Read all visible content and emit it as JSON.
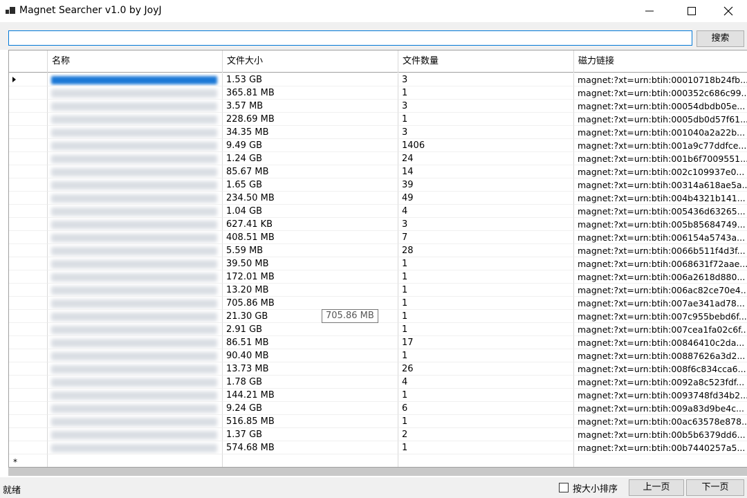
{
  "window": {
    "title": "Magnet Searcher v1.0 by JoyJ"
  },
  "search": {
    "value": "",
    "button_label": "搜索"
  },
  "grid": {
    "columns": [
      "名称",
      "文件大小",
      "文件数量",
      "磁力链接"
    ],
    "rows": [
      {
        "size": "1.53 GB",
        "count": "3",
        "magnet": "magnet:?xt=urn:btih:00010718b24fb..."
      },
      {
        "size": "365.81 MB",
        "count": "1",
        "magnet": "magnet:?xt=urn:btih:000352c686c99..."
      },
      {
        "size": "3.57 MB",
        "count": "3",
        "magnet": "magnet:?xt=urn:btih:00054dbdb05e..."
      },
      {
        "size": "228.69 MB",
        "count": "1",
        "magnet": "magnet:?xt=urn:btih:0005db0d57f61..."
      },
      {
        "size": "34.35 MB",
        "count": "3",
        "magnet": "magnet:?xt=urn:btih:001040a2a22b..."
      },
      {
        "size": "9.49 GB",
        "count": "1406",
        "magnet": "magnet:?xt=urn:btih:001a9c77ddfce..."
      },
      {
        "size": "1.24 GB",
        "count": "24",
        "magnet": "magnet:?xt=urn:btih:001b6f7009551..."
      },
      {
        "size": "85.67 MB",
        "count": "14",
        "magnet": "magnet:?xt=urn:btih:002c109937e0..."
      },
      {
        "size": "1.65 GB",
        "count": "39",
        "magnet": "magnet:?xt=urn:btih:00314a618ae5a..."
      },
      {
        "size": "234.50 MB",
        "count": "49",
        "magnet": "magnet:?xt=urn:btih:004b4321b141..."
      },
      {
        "size": "1.04 GB",
        "count": "4",
        "magnet": "magnet:?xt=urn:btih:005436d63265..."
      },
      {
        "size": "627.41 KB",
        "count": "3",
        "magnet": "magnet:?xt=urn:btih:005b85684749..."
      },
      {
        "size": "408.51 MB",
        "count": "7",
        "magnet": "magnet:?xt=urn:btih:006154a5743a..."
      },
      {
        "size": "5.59 MB",
        "count": "28",
        "magnet": "magnet:?xt=urn:btih:0066b511f4d3f..."
      },
      {
        "size": "39.50 MB",
        "count": "1",
        "magnet": "magnet:?xt=urn:btih:0068631f72aae..."
      },
      {
        "size": "172.01 MB",
        "count": "1",
        "magnet": "magnet:?xt=urn:btih:006a2618d880..."
      },
      {
        "size": "13.20 MB",
        "count": "1",
        "magnet": "magnet:?xt=urn:btih:006ac82ce70e4..."
      },
      {
        "size": "705.86 MB",
        "count": "1",
        "magnet": "magnet:?xt=urn:btih:007ae341ad78..."
      },
      {
        "size": "21.30 GB",
        "count": "1",
        "magnet": "magnet:?xt=urn:btih:007c955bebd6f..."
      },
      {
        "size": "2.91 GB",
        "count": "1",
        "magnet": "magnet:?xt=urn:btih:007cea1fa02c6f..."
      },
      {
        "size": "86.51 MB",
        "count": "17",
        "magnet": "magnet:?xt=urn:btih:00846410c2da..."
      },
      {
        "size": "90.40 MB",
        "count": "1",
        "magnet": "magnet:?xt=urn:btih:00887626a3d2..."
      },
      {
        "size": "13.73 MB",
        "count": "26",
        "magnet": "magnet:?xt=urn:btih:008f6c834cca6..."
      },
      {
        "size": "1.78 GB",
        "count": "4",
        "magnet": "magnet:?xt=urn:btih:0092a8c523fdf..."
      },
      {
        "size": "144.21 MB",
        "count": "1",
        "magnet": "magnet:?xt=urn:btih:0093748fd34b2..."
      },
      {
        "size": "9.24 GB",
        "count": "6",
        "magnet": "magnet:?xt=urn:btih:009a83d9be4c..."
      },
      {
        "size": "516.85 MB",
        "count": "1",
        "magnet": "magnet:?xt=urn:btih:00ac63578e878..."
      },
      {
        "size": "1.37 GB",
        "count": "2",
        "magnet": "magnet:?xt=urn:btih:00b5b6379dd6..."
      },
      {
        "size": "574.68 MB",
        "count": "1",
        "magnet": "magnet:?xt=urn:btih:00b7440257a5..."
      }
    ],
    "new_row_marker": "*",
    "tooltip": "705.86 MB"
  },
  "status": {
    "text": "就绪",
    "sort_label": "按大小排序",
    "sort_checked": false,
    "prev_label": "上一页",
    "next_label": "下一页"
  },
  "icons": {
    "app": "app-window-icon",
    "minimize": "minimize-icon",
    "maximize": "maximize-icon",
    "close": "close-icon",
    "current_row": "row-pointer-icon"
  },
  "colors": {
    "selection": "#1b78d6",
    "focus_border": "#0078d7",
    "chrome": "#f0f0f0"
  }
}
